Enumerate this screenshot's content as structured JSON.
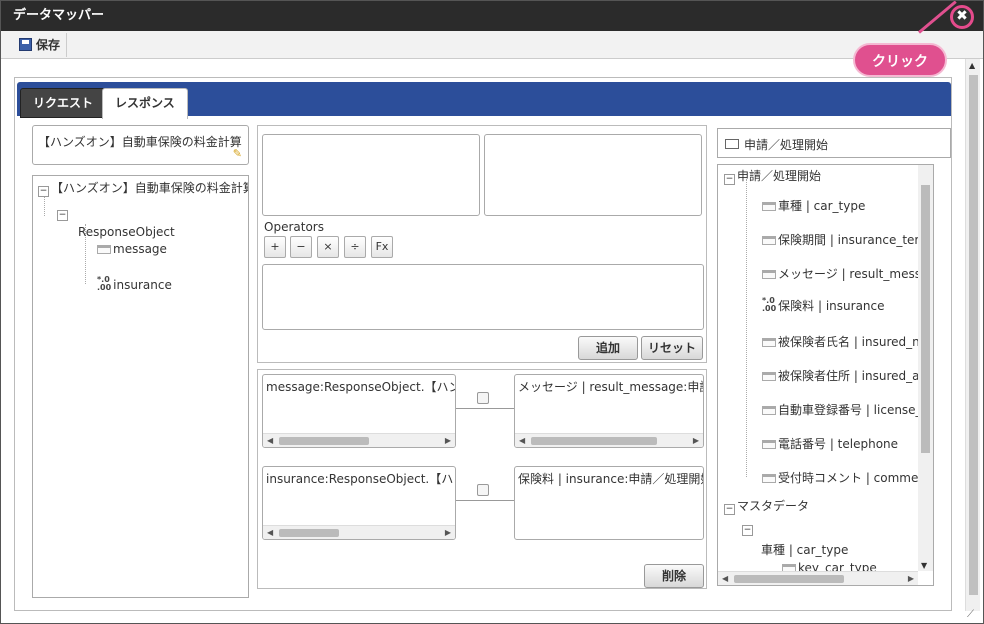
{
  "window": {
    "title": "データマッパー"
  },
  "toolbar": {
    "save_label": "保存"
  },
  "callout": {
    "text": "クリック"
  },
  "tabs": [
    {
      "label": "リクエスト"
    },
    {
      "label": "レスポンス"
    }
  ],
  "left": {
    "header": "【ハンズオン】自動車保険の料金計算",
    "tree": [
      {
        "label": "【ハンズオン】自動車保険の料金計算"
      },
      {
        "label": "ResponseObject"
      },
      {
        "label": "message"
      },
      {
        "label": "insurance"
      }
    ]
  },
  "center": {
    "operators_label": "Operators",
    "operators": [
      "+",
      "−",
      "×",
      "÷",
      "Fx"
    ],
    "add_label": "追加",
    "reset_label": "リセット",
    "mappings": [
      {
        "source": "message:ResponseObject.【ハンズ",
        "target": "メッセージ | result_message:申請／"
      },
      {
        "source": "insurance:ResponseObject.【ハンス",
        "target": "保険料 | insurance:申請／処理開始"
      }
    ],
    "delete_label": "削除"
  },
  "right": {
    "header": "申請／処理開始",
    "tree": [
      {
        "label": "申請／処理開始"
      },
      {
        "label": "車種 | car_type"
      },
      {
        "label": "保険期間 | insurance_term"
      },
      {
        "label": "メッセージ | result_message"
      },
      {
        "label": "保険料 | insurance"
      },
      {
        "label": "被保険者氏名 | insured_name"
      },
      {
        "label": "被保険者住所 | insured_address"
      },
      {
        "label": "自動車登録番号 | license_"
      },
      {
        "label": "電話番号 | telephone"
      },
      {
        "label": "受付時コメント | comment"
      },
      {
        "label": "マスタデータ"
      },
      {
        "label": "車種 | car_type"
      },
      {
        "label": "key_car_type"
      }
    ]
  }
}
